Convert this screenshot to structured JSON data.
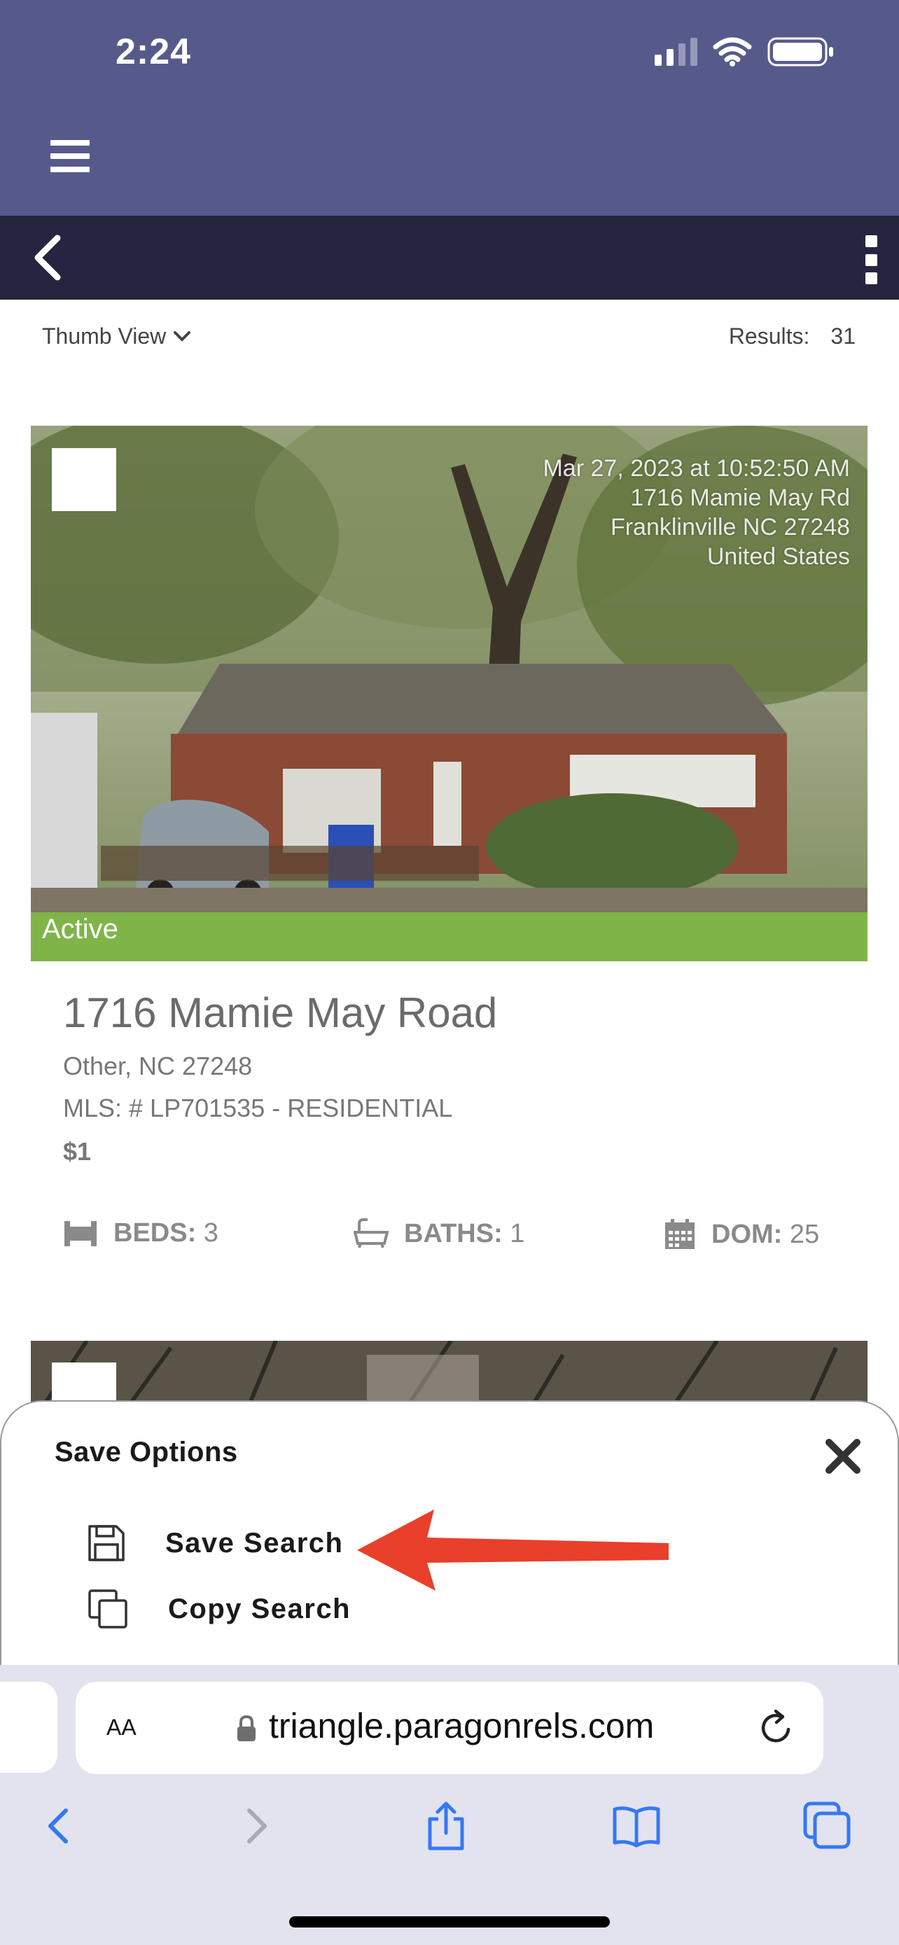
{
  "status_bar": {
    "time": "2:24"
  },
  "toolbar": {
    "view_label": "Thumb View",
    "results_label": "Results:",
    "results_count": "31"
  },
  "listing": {
    "photo_stamp": [
      "Mar 27, 2023 at 10:52:50 AM",
      "1716 Mamie May Rd",
      "Franklinville NC 27248",
      "United States"
    ],
    "status": "Active",
    "address": "1716 Mamie May Road",
    "city_line": "Other, NC 27248",
    "mls_line": "MLS: # LP701535 - RESIDENTIAL",
    "price": "$1",
    "beds_label": "BEDS:",
    "beds": "3",
    "baths_label": "BATHS:",
    "baths": "1",
    "dom_label": "DOM:",
    "dom": "25"
  },
  "save_sheet": {
    "title": "Save Options",
    "options": [
      {
        "label": "Save Search",
        "icon": "floppy-disk-icon"
      },
      {
        "label": "Copy Search",
        "icon": "copy-icon"
      }
    ],
    "annotation_color": "#e8402a"
  },
  "browser": {
    "text_size_label": "AA",
    "url": "triangle.paragonrels.com"
  },
  "colors": {
    "header": "#565a8b",
    "navbar": "#26253f",
    "safari_accent": "#3478f6"
  }
}
